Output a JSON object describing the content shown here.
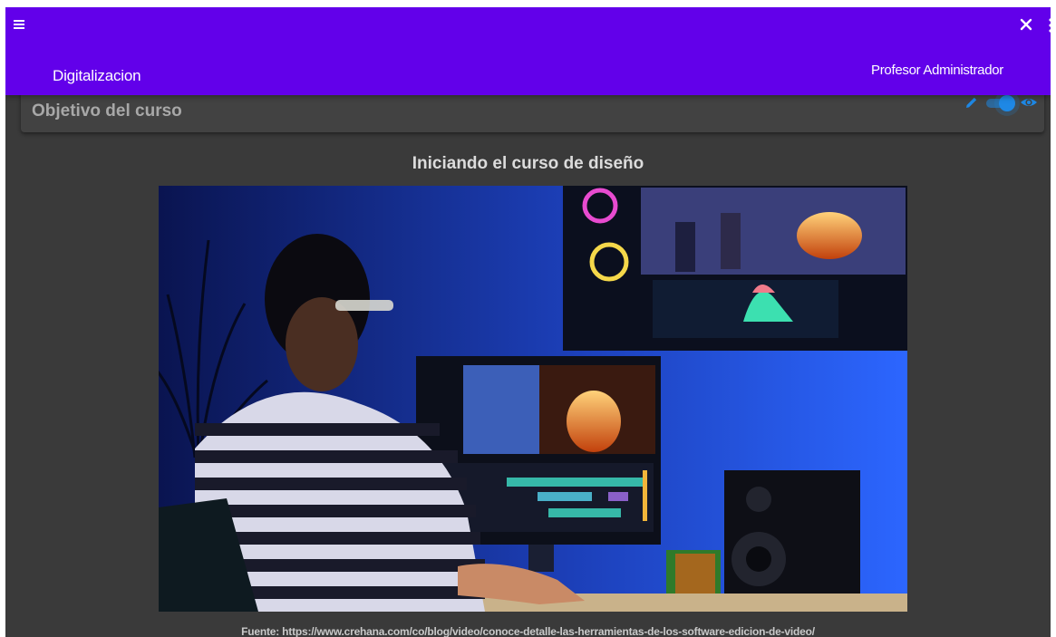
{
  "header": {
    "app_title": "Digitalizacion",
    "user_name": "Profesor Administrador",
    "icons": [
      "menu-icon",
      "close-icon",
      "more-vert-icon"
    ],
    "background_color": "#6200ea"
  },
  "card": {
    "title": "Objetivo del curso",
    "actions": [
      "edit-icon",
      "visibility-toggle",
      "eye-icon"
    ],
    "toggle_on": true,
    "accent_color": "#1e88e5"
  },
  "content": {
    "heading": "Iniciando el curso de diseño",
    "image_alt": "Hombre editando video frente a varios monitores",
    "caption": "Fuente: https://www.crehana.com/co/blog/video/conoce-detalle-las-herramientas-de-los-software-edicion-de-video/"
  }
}
